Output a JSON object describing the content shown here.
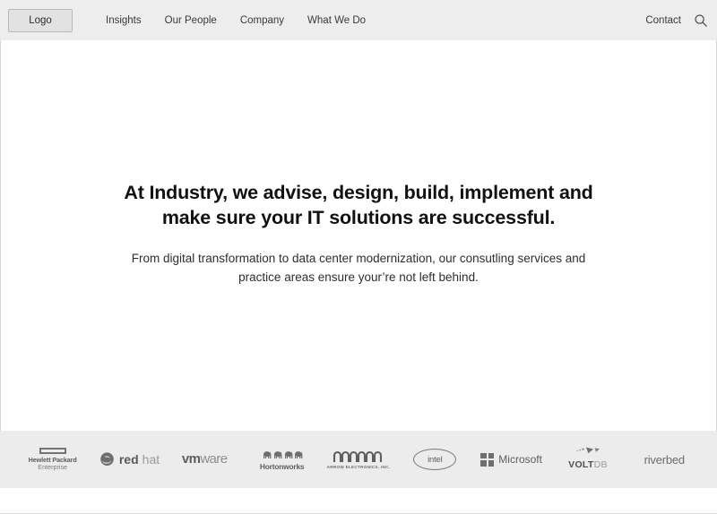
{
  "header": {
    "logo_label": "Logo",
    "nav_items": [
      {
        "label": "Insights"
      },
      {
        "label": "Our People"
      },
      {
        "label": "Company"
      },
      {
        "label": "What We Do"
      }
    ],
    "contact_label": "Contact",
    "search_icon": "search-icon",
    "background_color": "#ededed"
  },
  "hero": {
    "headline": "At Industry, we advise, design, build, implement and make sure your IT solutions are successful.",
    "subhead": "From digital transformation to data center modernization, our consutling services and practice areas ensure your’re not left behind.",
    "background_color": "#ffffff",
    "text_color": "#111111"
  },
  "partners": {
    "background_color": "#ececec",
    "logos": [
      {
        "name": "hpe",
        "line1": "Hewlett Packard",
        "line2": "Enterprise"
      },
      {
        "name": "redhat",
        "word1": "red",
        "word2": "hat"
      },
      {
        "name": "vmware",
        "word1": "vm",
        "word2": "ware",
        "tm": "·"
      },
      {
        "name": "hortonworks",
        "label": "Hortonworks"
      },
      {
        "name": "arrow",
        "label": "ARROW ELECTRONICS, INC."
      },
      {
        "name": "intel",
        "label": "intel"
      },
      {
        "name": "microsoft",
        "label": "Microsoft"
      },
      {
        "name": "voltdb",
        "word1": "VOLT",
        "word2": "DB"
      },
      {
        "name": "riverbed",
        "label": "riverbed"
      }
    ]
  }
}
